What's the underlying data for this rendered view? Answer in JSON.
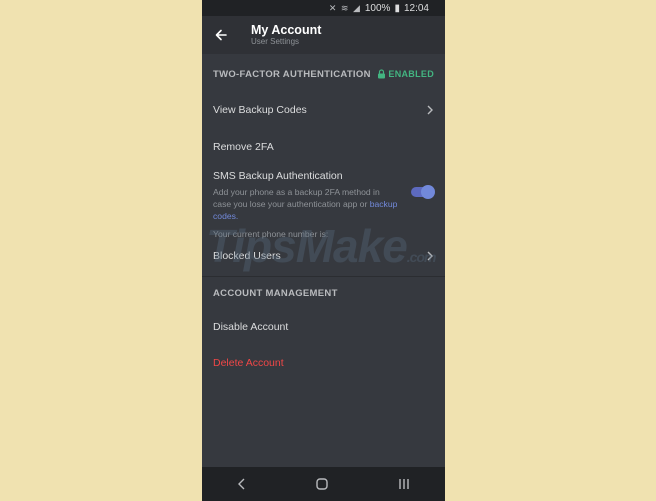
{
  "status_bar": {
    "battery": "100%",
    "time": "12:04"
  },
  "app_bar": {
    "title": "My Account",
    "subtitle": "User Settings"
  },
  "two_factor": {
    "header": "TWO-FACTOR AUTHENTICATION",
    "badge": "ENABLED",
    "view_backup_codes": "View Backup Codes",
    "remove_2fa": "Remove 2FA",
    "sms_title": "SMS Backup Authentication",
    "sms_desc": "Add your phone as a backup 2FA method in case you lose your authentication app or",
    "sms_desc_link": "backup codes.",
    "sms_enabled": true,
    "phone_label": "Your current phone number is:"
  },
  "blocked_users": "Blocked Users",
  "account_management": {
    "header": "ACCOUNT MANAGEMENT",
    "disable": "Disable Account",
    "delete": "Delete Account"
  },
  "watermark": {
    "text": "TipsMake",
    "suffix": ".com"
  },
  "colors": {
    "accent": "#7289da",
    "enabled": "#43b581",
    "danger": "#f04747",
    "background": "#36393f"
  },
  "icons": [
    "back-arrow-icon",
    "lock-icon",
    "chevron-right-icon",
    "nav-back-icon",
    "nav-home-icon",
    "nav-recents-icon"
  ]
}
